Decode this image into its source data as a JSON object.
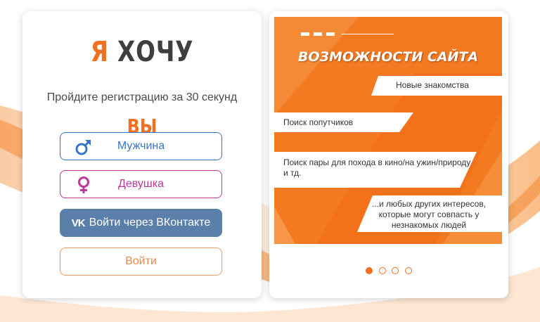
{
  "logo": {
    "ya": "Я",
    "want": "ХОЧУ"
  },
  "registration": {
    "subtitle": "Пройдите регистрацию за 30 секунд",
    "you_heading": "ВЫ",
    "male_button": "Мужчина",
    "female_button": "Девушка",
    "vk_button": "Войти через ВКонтакте",
    "vk_icon_text": "VK",
    "login_button": "Войти"
  },
  "promo": {
    "title": "ВОЗМОЖНОСТИ САЙТА",
    "features": [
      "Новые знакомства",
      "Поиск попутчиков",
      "Поиск пары для похода в кино/на ужин/природу и тд.",
      "...и любых других интересов, которые могут совпасть у незнакомых людей"
    ]
  },
  "carousel": {
    "active_index": 0,
    "total": 4
  },
  "icons": {
    "male": "male-symbol-icon",
    "female": "female-symbol-icon",
    "vk": "vk-logo-icon"
  },
  "colors": {
    "brand_orange": "#f37021",
    "male_blue": "#3a74c9",
    "female_pink": "#c0369a",
    "vk_blue": "#5b7fab",
    "text_dark": "#3f3f3f"
  }
}
